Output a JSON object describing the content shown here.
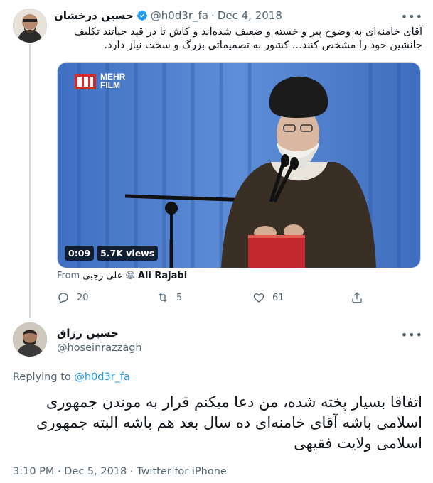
{
  "tweet": {
    "author_name": "حسین درخشان",
    "author_handle": "@h0d3r_fa",
    "date": "Dec 4, 2018",
    "separator": "·",
    "text": "آقای خامنه‌ای به وضوح پیر و خسته و ضعیف شده‌اند و کاش تا در قید حیاتند تکلیف جانشین خود را مشخص کنند... کشور به تصمیماتی بزرگ و سخت نیاز دارد.",
    "video": {
      "logo_line1": "MEHR",
      "logo_line2": "FILM",
      "duration": "0:09",
      "views": "5.7K views"
    },
    "from_label": "From",
    "from_source_fa": "علی رجبی",
    "from_emoji": "😁",
    "from_source_en": "Ali Rajabi",
    "actions": {
      "reply_count": "20",
      "retweet_count": "5",
      "like_count": "61"
    }
  },
  "reply": {
    "author_name": "حسین رزاق",
    "author_handle": "@hoseinrazzagh",
    "replying_prefix": "Replying to",
    "replying_to": "@h0d3r_fa",
    "text": "اتفاقا بسیار پخته شده، من دعا میکنم قرار به موندن جمهوری اسلامی باشه آقای خامنه‌ای ده سال بعد هم باشه البته جمهوری اسلامی ولایت فقیهی",
    "time": "3:10 PM",
    "date": "Dec 5, 2018",
    "client": "Twitter for iPhone",
    "separator": "·"
  },
  "colors": {
    "accent": "#1d9bf0",
    "muted": "#536471",
    "text": "#0f1419"
  }
}
